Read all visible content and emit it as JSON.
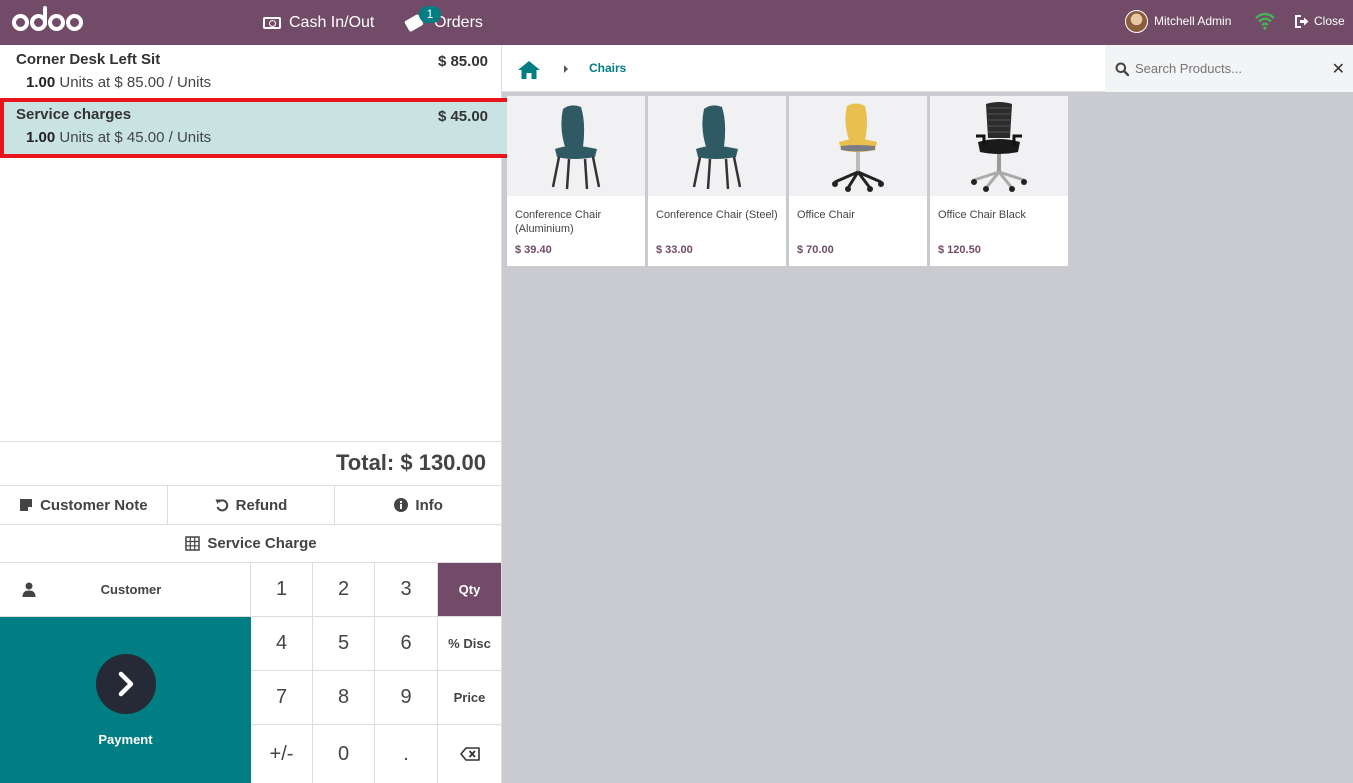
{
  "topbar": {
    "cash_label": "Cash In/Out",
    "orders_label": "Orders",
    "orders_count": "1",
    "user_name": "Mitchell Admin",
    "close_label": "Close"
  },
  "orderlines": [
    {
      "name": "Corner Desk Left Sit",
      "price": "$ 85.00",
      "qty": "1.00",
      "detail": "Units at $ 85.00 / Units"
    },
    {
      "name": "Service charges",
      "price": "$ 45.00",
      "qty": "1.00",
      "detail": "Units at $ 45.00 / Units"
    }
  ],
  "total": "Total: $ 130.00",
  "controls": {
    "customer_note": "Customer Note",
    "refund": "Refund",
    "info": "Info",
    "service_charge": "Service Charge"
  },
  "numpad": {
    "customer": "Customer",
    "payment": "Payment",
    "keys": [
      "1",
      "2",
      "3",
      "Qty",
      "4",
      "5",
      "6",
      "% Disc",
      "7",
      "8",
      "9",
      "Price",
      "+/-",
      "0",
      "."
    ]
  },
  "breadcrumb": {
    "category": "Chairs"
  },
  "search": {
    "placeholder": "Search Products..."
  },
  "products": [
    {
      "name": "Conference Chair (Aluminium)",
      "price": "$ 39.40"
    },
    {
      "name": "Conference Chair (Steel)",
      "price": "$ 33.00"
    },
    {
      "name": "Office Chair",
      "price": "$ 70.00"
    },
    {
      "name": "Office Chair Black",
      "price": "$ 120.50"
    }
  ],
  "colors": {
    "brand": "#714b67",
    "accent": "#017e84",
    "selected_outline": "#e8141c"
  }
}
